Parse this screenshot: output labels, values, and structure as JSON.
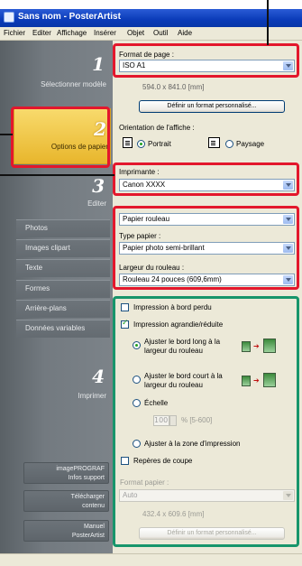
{
  "window": {
    "title": "Sans nom - PosterArtist"
  },
  "menu": [
    "Fichier",
    "Editer",
    "Affichage",
    "Insérer",
    "Objet",
    "Outil",
    "Aide"
  ],
  "steps": [
    {
      "number": "1",
      "label": "Sélectionner modèle"
    },
    {
      "number": "2",
      "label": "Options de papier"
    },
    {
      "number": "3",
      "label": "Editer"
    },
    {
      "number": "4",
      "label": "Imprimer"
    }
  ],
  "edit_items": [
    "Photos",
    "Images clipart",
    "Texte",
    "Formes",
    "Arrière-plans",
    "Données variables"
  ],
  "side_buttons": [
    {
      "line1": "imagePROGRAF",
      "line2": "Infos support"
    },
    {
      "line1": "Télécharger",
      "line2": "contenu"
    },
    {
      "line1": "Manuel",
      "line2": "PosterArtist"
    }
  ],
  "page_format": {
    "label": "Format de page :",
    "value": "ISO A1",
    "size_text": "594.0 x 841.0 [mm]",
    "custom_button": "Définir un format personnalisé..."
  },
  "orientation": {
    "label": "Orientation de l'affiche :",
    "portrait": "Portrait",
    "landscape": "Paysage",
    "selected": "portrait"
  },
  "printer": {
    "label": "Imprimante :",
    "value": "Canon XXXX"
  },
  "paper_source": {
    "value": "Papier rouleau"
  },
  "paper_type": {
    "label": "Type papier :",
    "value": "Papier photo semi-brillant"
  },
  "roll_width": {
    "label": "Largeur du rouleau :",
    "value": "Rouleau 24 pouces (609,6mm)"
  },
  "print_options": {
    "borderless": {
      "label": "Impression à bord perdu",
      "checked": false
    },
    "scaled": {
      "label": "Impression agrandie/réduite",
      "checked": true
    },
    "fit_long_line1": "Ajuster le bord long à la",
    "fit_long_line2": "largeur du rouleau",
    "fit_short_line1": "Ajuster le bord court à la",
    "fit_short_line2": "largeur du rouleau",
    "scale_label": "Échelle",
    "scale_value": "100",
    "scale_range": "% [5-600]",
    "fit_print_area": "Ajuster à la zone d'impression",
    "crop_marks": {
      "label": "Repères de coupe",
      "checked": false
    }
  },
  "paper_format": {
    "label": "Format papier :",
    "value": "Auto",
    "size_text": "432.4 x 609.6 [mm]",
    "custom_button": "Définir un format personnalisé..."
  },
  "colors": {
    "highlight_red": "#e3172c",
    "highlight_green": "#17956b",
    "active_step": "#f0c848"
  }
}
